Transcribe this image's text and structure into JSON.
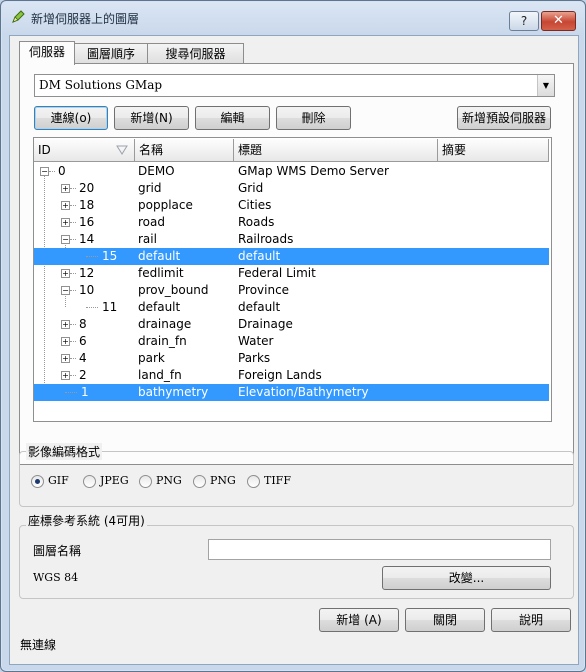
{
  "window": {
    "title": "新增伺服器上的圖層",
    "help_label": "?",
    "close_label": "✕"
  },
  "tabs": [
    {
      "label": "伺服器"
    },
    {
      "label": "圖層順序"
    },
    {
      "label": "搜尋伺服器"
    }
  ],
  "server": {
    "selected": "DM Solutions GMap",
    "connect_label": "連線(o)",
    "new_label": "新增(N)",
    "edit_label": "編輯",
    "delete_label": "刪除",
    "add_default_label": "新增預設伺服器"
  },
  "layers_table": {
    "columns": [
      "ID",
      "名稱",
      "標題",
      "摘要"
    ],
    "rows": [
      {
        "id": "0",
        "name": "DEMO",
        "title": "GMap WMS Demo Server"
      },
      {
        "id": "20",
        "name": "grid",
        "title": "Grid"
      },
      {
        "id": "18",
        "name": "popplace",
        "title": "Cities"
      },
      {
        "id": "16",
        "name": "road",
        "title": "Roads"
      },
      {
        "id": "14",
        "name": "rail",
        "title": "Railroads"
      },
      {
        "id": "15",
        "name": "default",
        "title": "default"
      },
      {
        "id": "12",
        "name": "fedlimit",
        "title": "Federal Limit"
      },
      {
        "id": "10",
        "name": "prov_bound",
        "title": "Province"
      },
      {
        "id": "11",
        "name": "default",
        "title": "default"
      },
      {
        "id": "8",
        "name": "drainage",
        "title": "Drainage"
      },
      {
        "id": "6",
        "name": "drain_fn",
        "title": "Water"
      },
      {
        "id": "4",
        "name": "park",
        "title": "Parks"
      },
      {
        "id": "2",
        "name": "land_fn",
        "title": "Foreign Lands"
      },
      {
        "id": "1",
        "name": "bathymetry",
        "title": "Elevation/Bathymetry"
      }
    ]
  },
  "image_format": {
    "group_label": "影像編碼格式",
    "options": [
      "GIF",
      "JPEG",
      "PNG",
      "PNG",
      "TIFF"
    ],
    "selected": "GIF"
  },
  "crs": {
    "group_label": "座標參考系統 (4可用)",
    "layer_name_label": "圖層名稱",
    "layer_name_value": "",
    "current": "WGS 84",
    "change_label": "改變..."
  },
  "footer": {
    "add_label": "新增 (A)",
    "close_label": "關閉",
    "help_label": "說明",
    "status": "無連線"
  },
  "colors": {
    "selection": "#3399ff"
  },
  "icons": {
    "app": "qgis-pencil-icon",
    "sort": "sort-indicator-icon"
  }
}
